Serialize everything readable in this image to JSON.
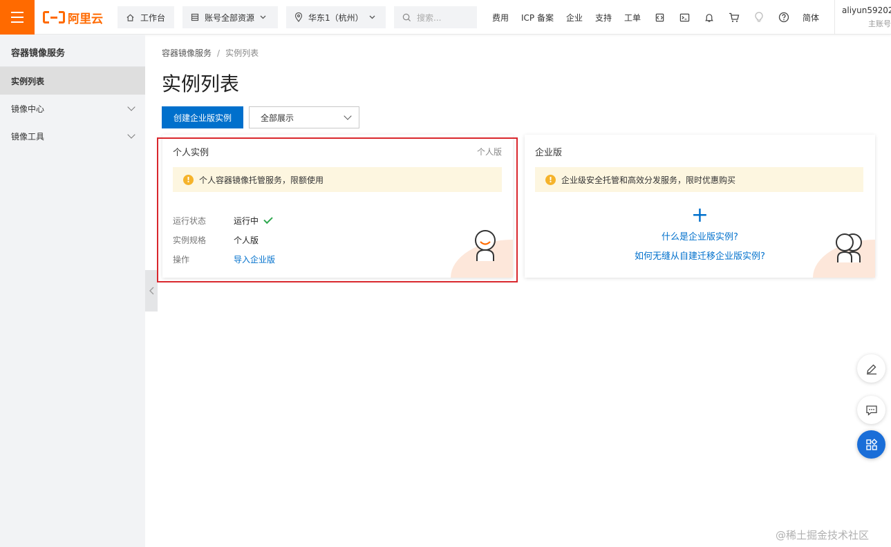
{
  "header": {
    "logo_text": "阿里云",
    "workbench_label": "工作台",
    "resources_label": "账号全部资源",
    "region_label": "华东1（杭州）",
    "search_placeholder": "搜索...",
    "nav": [
      "费用",
      "ICP 备案",
      "企业",
      "支持",
      "工单"
    ],
    "lang_label": "简体",
    "user_name": "aliyun59202...",
    "user_type": "主账号"
  },
  "sidebar": {
    "title": "容器镜像服务",
    "items": [
      {
        "label": "实例列表",
        "active": true
      },
      {
        "label": "镜像中心",
        "expandable": true
      },
      {
        "label": "镜像工具",
        "expandable": true
      }
    ]
  },
  "main": {
    "breadcrumb": [
      "容器镜像服务",
      "实例列表"
    ],
    "breadcrumb_sep": "/",
    "title": "实例列表",
    "create_button": "创建企业版实例",
    "filter_select": "全部展示"
  },
  "personal_card": {
    "title": "个人实例",
    "tag": "个人版",
    "notice": "个人容器镜像托管服务，限额使用",
    "rows": [
      {
        "key": "运行状态",
        "value": "运行中"
      },
      {
        "key": "实例规格",
        "value": "个人版"
      },
      {
        "key": "操作",
        "value": "导入企业版"
      }
    ]
  },
  "enterprise_card": {
    "title": "企业版",
    "notice": "企业级安全托管和高效分发服务，限时优惠购买",
    "plus": "+",
    "link_what": "什么是企业版实例?",
    "link_migrate": "如何无缝从自建迁移企业版实例?"
  },
  "watermark": "@稀土掘金技术社区",
  "colors": {
    "brand_orange": "#ff6a00",
    "primary_blue": "#0070cc",
    "highlight_red": "#d9262c",
    "notice_bg": "#fdf6e0",
    "success_green": "#2fa84f"
  }
}
